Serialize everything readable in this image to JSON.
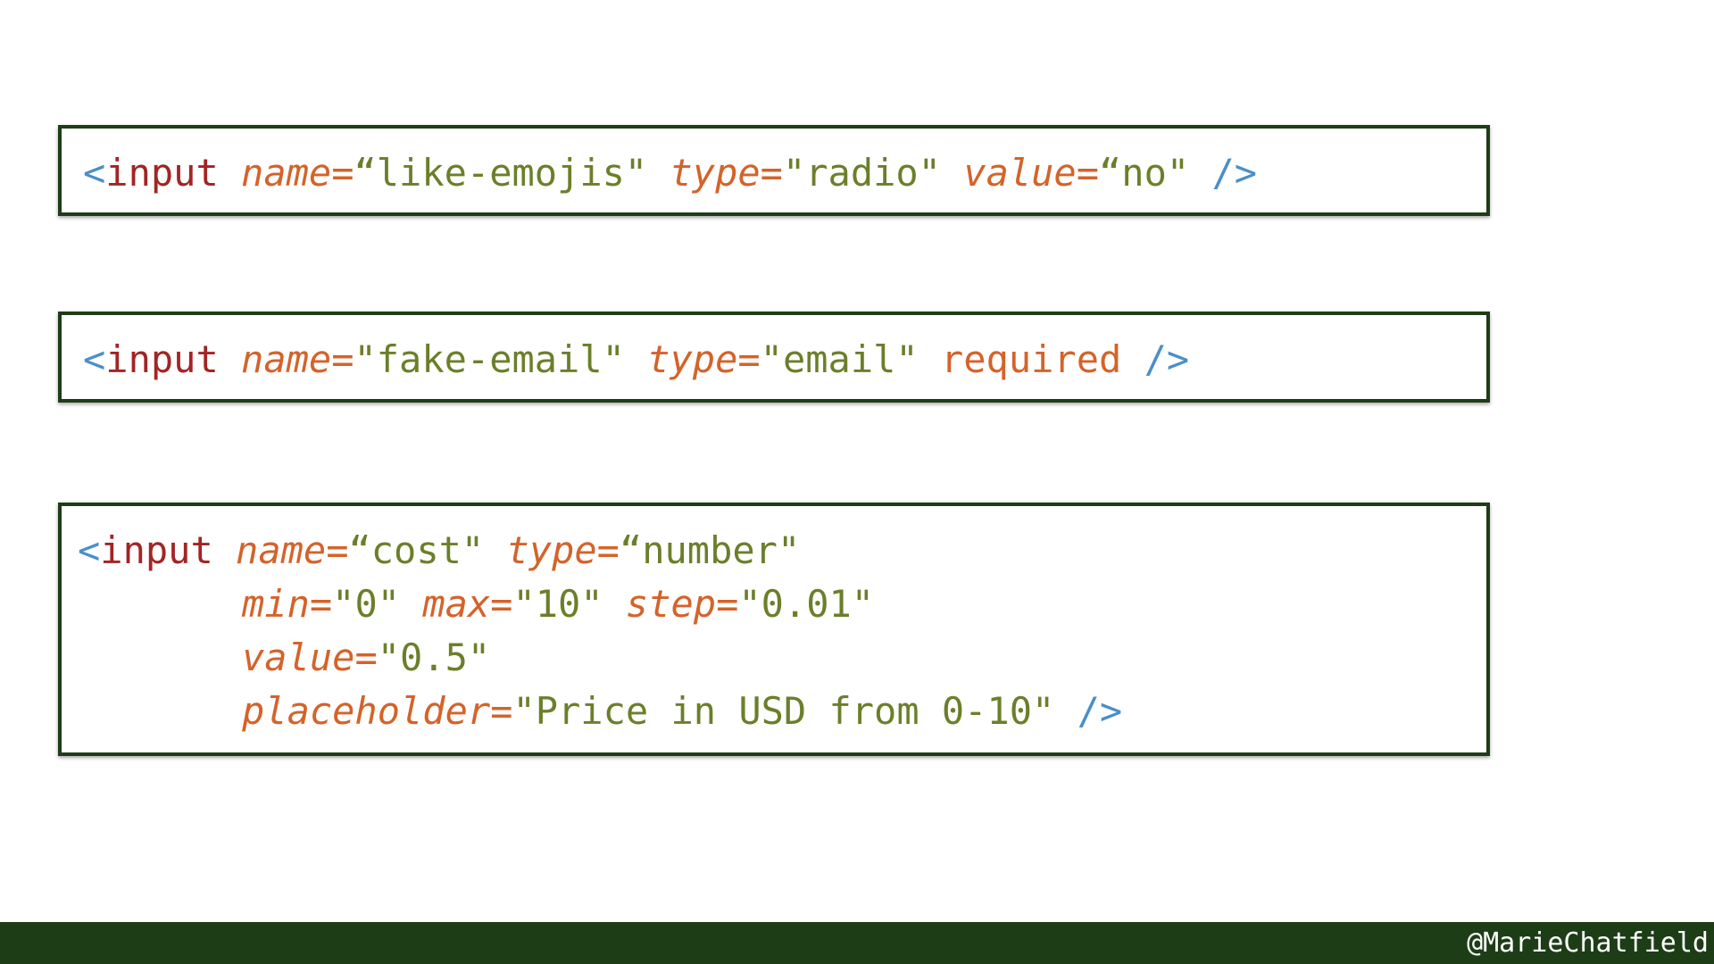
{
  "syntax": {
    "open": "<",
    "tag": "input",
    "eq": "=",
    "close": "/>"
  },
  "snippet1": {
    "attr1": "name",
    "val1": "“like-emojis\"",
    "attr2": "type",
    "val2": "\"radio\"",
    "attr3": "value",
    "val3": "“no\""
  },
  "snippet2": {
    "attr1": "name",
    "val1": "\"fake-email\"",
    "attr2": "type",
    "val2": "\"email\"",
    "keyword": "required"
  },
  "snippet3": {
    "attr1": "name",
    "val1": "“cost\"",
    "attr2": "type",
    "val2": "“number\"",
    "attr3": "min",
    "val3": "\"0\"",
    "attr4": "max",
    "val4": "\"10\"",
    "attr5": "step",
    "val5": "\"0.01\"",
    "attr6": "value",
    "val6": "\"0.5\"",
    "attr7": "placeholder",
    "val7": "\"Price in USD from 0-10\""
  },
  "footer": {
    "handle": "@MarieChatfield"
  },
  "colors": {
    "frame": "#1d3d17",
    "bracket": "#4a8fc8",
    "tag": "#a32424",
    "attribute": "#d4632a",
    "value": "#6b7f2a"
  }
}
